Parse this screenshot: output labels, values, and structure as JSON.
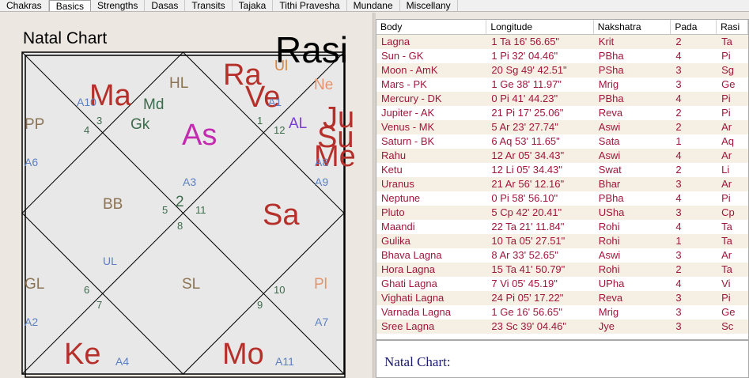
{
  "tabs": [
    "Chakras",
    "Basics",
    "Strengths",
    "Dasas",
    "Transits",
    "Tajaka",
    "Tithi Pravesha",
    "Mundane",
    "Miscellany"
  ],
  "chart": {
    "title": "Natal Chart",
    "chart_name": "Rasi",
    "labels": {
      "ma": "Ma",
      "hl": "HL",
      "ra": "Ra",
      "ve": "Ve",
      "ul_top": "Ul",
      "ne": "Ne",
      "a10": "A10",
      "a1": "A1",
      "md": "Md",
      "gk": "Gk",
      "as": "As",
      "al": "AL",
      "ju": "Ju",
      "su": "Su",
      "me": "Me",
      "pp": "PP",
      "a6": "A6",
      "a8": "A8",
      "a3": "A3",
      "a9": "A9",
      "bb": "BB",
      "sa": "Sa",
      "ul": "UL",
      "gl": "GL",
      "sl": "SL",
      "pl": "Pl",
      "a2": "A2",
      "a7": "A7",
      "ke": "Ke",
      "a4": "A4",
      "mo": "Mo",
      "a11": "A11"
    },
    "house_numbers": {
      "h1": "1",
      "h2": "2",
      "h3": "3",
      "h4": "4",
      "h5": "5",
      "h6": "6",
      "h7": "7",
      "h8": "8",
      "h9": "9",
      "h10": "10",
      "h11": "11",
      "h12": "12"
    }
  },
  "table": {
    "headers": [
      "Body",
      "Longitude",
      "Nakshatra",
      "Pada",
      "Rasi"
    ],
    "rows": [
      [
        "Lagna",
        "1 Ta 16' 56.65\"",
        "Krit",
        "2",
        "Ta"
      ],
      [
        "Sun - GK",
        "1 Pi 32' 04.46\"",
        "PBha",
        "4",
        "Pi"
      ],
      [
        "Moon - AmK",
        "20 Sg 49' 42.51\"",
        "PSha",
        "3",
        "Sg"
      ],
      [
        "Mars - PK",
        "1 Ge 38' 11.97\"",
        "Mrig",
        "3",
        "Ge"
      ],
      [
        "Mercury - DK",
        "0 Pi 41' 44.23\"",
        "PBha",
        "4",
        "Pi"
      ],
      [
        "Jupiter - AK",
        "21 Pi 17' 25.06\"",
        "Reva",
        "2",
        "Pi"
      ],
      [
        "Venus - MK",
        "5 Ar 23' 27.74\"",
        "Aswi",
        "2",
        "Ar"
      ],
      [
        "Saturn - BK",
        "6 Aq 53' 11.65\"",
        "Sata",
        "1",
        "Aq"
      ],
      [
        "Rahu",
        "12 Ar 05' 34.43\"",
        "Aswi",
        "4",
        "Ar"
      ],
      [
        "Ketu",
        "12 Li 05' 34.43\"",
        "Swat",
        "2",
        "Li"
      ],
      [
        "Uranus",
        "21 Ar 56' 12.16\"",
        "Bhar",
        "3",
        "Ar"
      ],
      [
        "Neptune",
        "0 Pi 58' 56.10\"",
        "PBha",
        "4",
        "Pi"
      ],
      [
        "Pluto",
        "5 Cp 42' 20.41\"",
        "USha",
        "3",
        "Cp"
      ],
      [
        "Maandi",
        "22 Ta 21' 11.84\"",
        "Rohi",
        "4",
        "Ta"
      ],
      [
        "Gulika",
        "10 Ta 05' 27.51\"",
        "Rohi",
        "1",
        "Ta"
      ],
      [
        "Bhava Lagna",
        "8 Ar 33' 52.65\"",
        "Aswi",
        "3",
        "Ar"
      ],
      [
        "Hora Lagna",
        "15 Ta 41' 50.79\"",
        "Rohi",
        "2",
        "Ta"
      ],
      [
        "Ghati Lagna",
        "7 Vi 05' 45.19\"",
        "UPha",
        "4",
        "Vi"
      ],
      [
        "Vighati Lagna",
        "24 Pi 05' 17.22\"",
        "Reva",
        "3",
        "Pi"
      ],
      [
        "Varnada Lagna",
        "1 Ge 16' 56.65\"",
        "Mrig",
        "3",
        "Ge"
      ],
      [
        "Sree Lagna",
        "23 Sc 39' 04.46\"",
        "Jye",
        "3",
        "Sc"
      ]
    ]
  },
  "note": {
    "title": "Natal Chart:"
  }
}
